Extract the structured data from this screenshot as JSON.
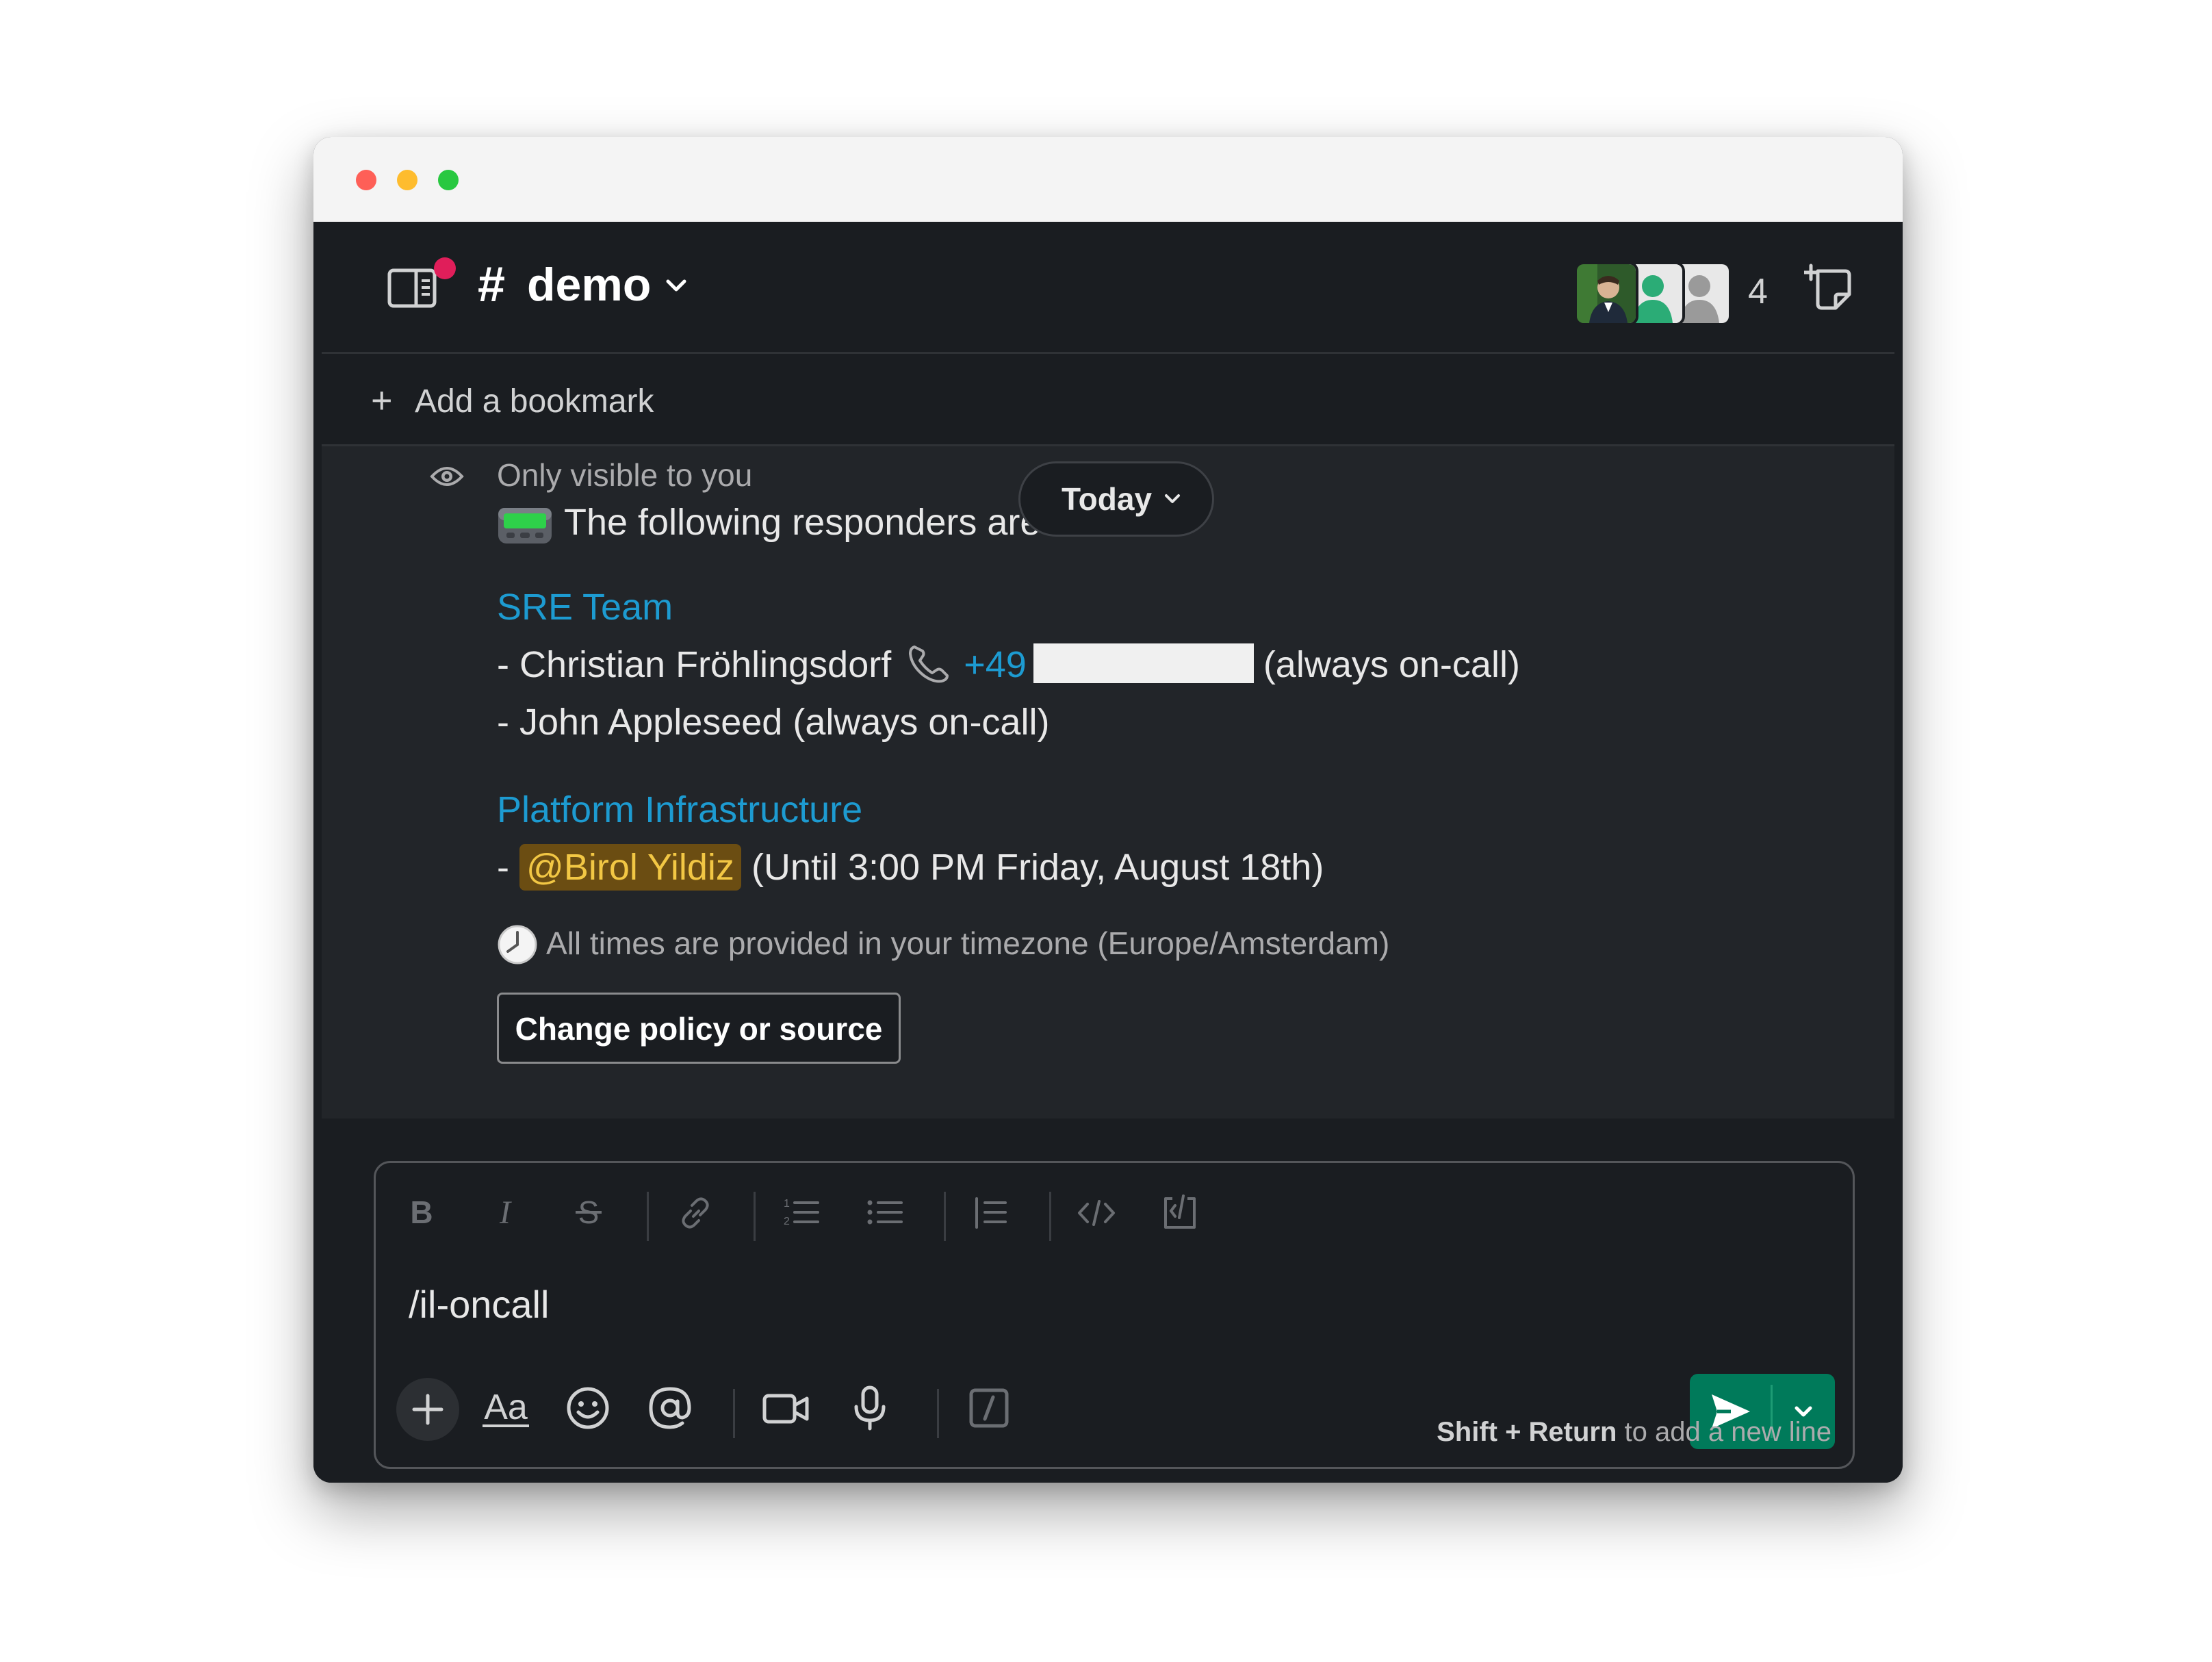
{
  "window": {
    "traffic_lights": [
      "close",
      "minimize",
      "zoom"
    ]
  },
  "header": {
    "channel_hash": "#",
    "channel_name": "demo",
    "member_count": "4",
    "colors": {
      "notification_dot": "#e01e5a"
    }
  },
  "bookmarks": {
    "add_label": "Add a bookmark"
  },
  "message": {
    "visibility_note": "Only visible to you",
    "date_divider": "Today",
    "intro": "The following responders are on call.",
    "groups": [
      {
        "title": "SRE Team",
        "responders": [
          {
            "prefix": "- ",
            "name": "Christian Fröhlingsdorf",
            "phone": "+49",
            "note": "(always on-call)"
          },
          {
            "prefix": "- ",
            "name": "John Appleseed",
            "note": "(always on-call)"
          }
        ]
      },
      {
        "title": "Platform Infrastructure",
        "responders": [
          {
            "prefix": "- ",
            "mention": "@Birol Yildiz",
            "note": "(Until 3:00 PM Friday, August 18th)"
          }
        ]
      }
    ],
    "timezone_note": "All times are provided in your timezone (Europe/Amsterdam)",
    "action_button": "Change policy or source"
  },
  "composer": {
    "text": "/il-oncall",
    "hint_keys": "Shift + Return",
    "hint_text": " to add a new line",
    "formatting_icons": [
      "bold-icon",
      "italic-icon",
      "strikethrough-icon",
      "link-icon",
      "ordered-list-icon",
      "bulleted-list-icon",
      "blockquote-icon",
      "code-icon",
      "code-block-icon"
    ],
    "bottom_icons": [
      "plus-icon",
      "text-format-icon",
      "emoji-icon",
      "mention-icon",
      "video-icon",
      "microphone-icon",
      "slash-command-icon",
      "send-icon",
      "chevron-down-icon"
    ],
    "colors": {
      "send_button": "#007a5a"
    }
  },
  "colors": {
    "link": "#1d9bd1",
    "mention_bg": "#6b4d12",
    "mention_text": "#f2c744",
    "app_bg": "#1a1d21",
    "message_bg": "#222529"
  }
}
